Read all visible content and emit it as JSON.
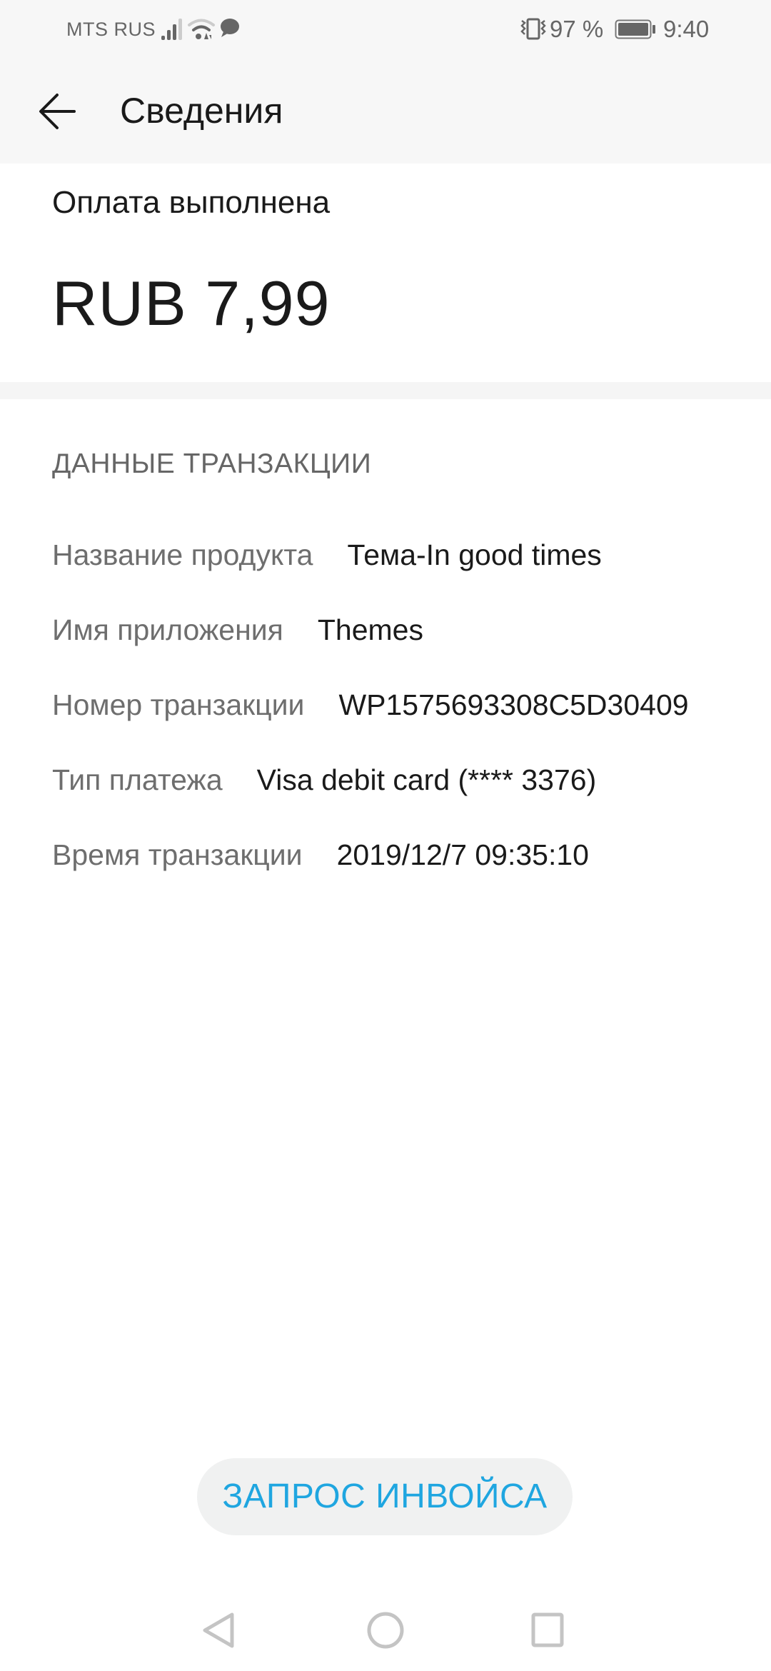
{
  "status_bar": {
    "carrier": "MTS RUS",
    "icons": [
      "signal-icon",
      "wifi-icon",
      "message-icon",
      "vibrate-icon",
      "battery-icon"
    ],
    "battery_percent": "97 %",
    "battery_level": 0.97,
    "time": "9:40"
  },
  "app_bar": {
    "back_icon": "arrow-left-icon",
    "title": "Сведения"
  },
  "summary": {
    "status": "Оплата выполнена",
    "amount": "RUB 7,99"
  },
  "transaction": {
    "section_title": "ДАННЫЕ ТРАНЗАКЦИИ",
    "rows": [
      {
        "label": "Название продукта",
        "value": "Тема-In good times"
      },
      {
        "label": "Имя приложения",
        "value": "Themes"
      },
      {
        "label": "Номер транзакции",
        "value": "WP1575693308C5D30409"
      },
      {
        "label": "Тип платежа",
        "value": "Visa debit card (**** 3376)"
      },
      {
        "label": "Время транзакции",
        "value": "2019/12/7 09:35:10"
      }
    ]
  },
  "actions": {
    "invoice_label": "ЗАПРОС ИНВОЙСА"
  },
  "colors": {
    "accent": "#1fa6e0",
    "header_bg": "#f7f7f7",
    "button_bg": "#f0f1f1"
  },
  "nav_bar": {
    "buttons": [
      "back-triangle-icon",
      "home-circle-icon",
      "recents-square-icon"
    ]
  }
}
